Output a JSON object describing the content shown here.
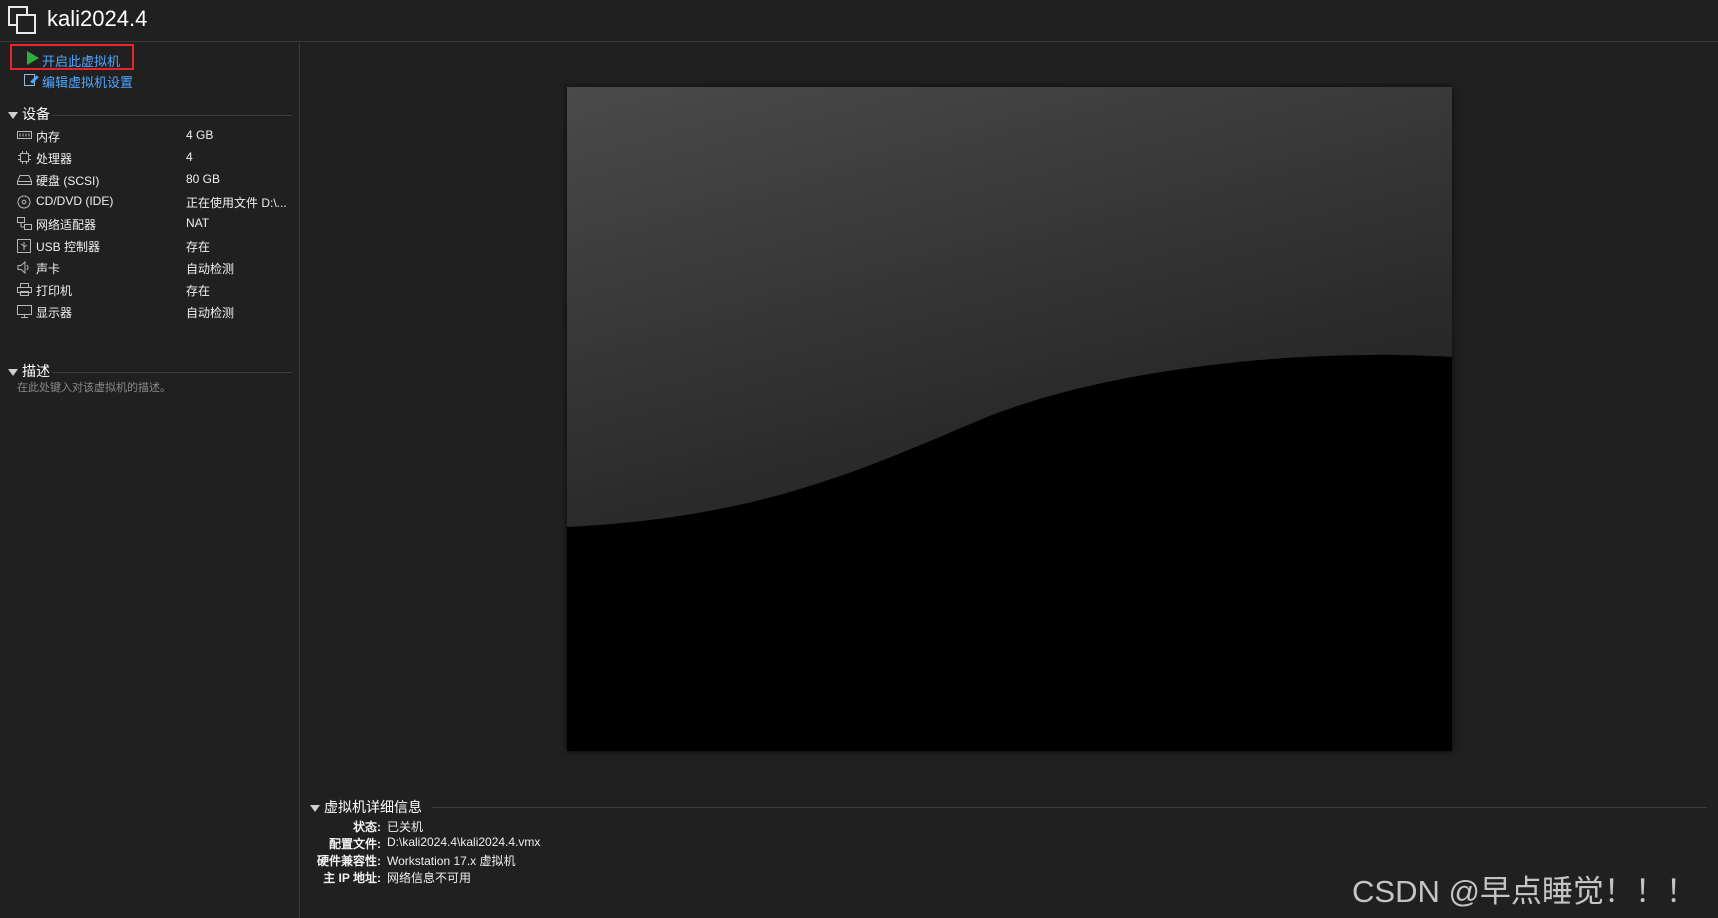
{
  "window": {
    "title": "kali2024.4",
    "icon": "vm-window-icon"
  },
  "actions": {
    "start": {
      "label": "开启此虚拟机",
      "icon": "play-icon",
      "color": "#2fae3b"
    },
    "edit": {
      "label": "编辑虚拟机设置",
      "icon": "edit-settings-icon"
    }
  },
  "devices": {
    "title": "设备",
    "items": [
      {
        "icon": "memory-icon",
        "name": "内存",
        "value": "4 GB"
      },
      {
        "icon": "processor-icon",
        "name": "处理器",
        "value": "4"
      },
      {
        "icon": "hard-disk-icon",
        "name": "硬盘 (SCSI)",
        "value": "80 GB"
      },
      {
        "icon": "cd-dvd-icon",
        "name": "CD/DVD (IDE)",
        "value": "正在使用文件 D:\\..."
      },
      {
        "icon": "network-adapter-icon",
        "name": "网络适配器",
        "value": "NAT"
      },
      {
        "icon": "usb-controller-icon",
        "name": "USB 控制器",
        "value": "存在"
      },
      {
        "icon": "sound-card-icon",
        "name": "声卡",
        "value": "自动检测"
      },
      {
        "icon": "printer-icon",
        "name": "打印机",
        "value": "存在"
      },
      {
        "icon": "display-icon",
        "name": "显示器",
        "value": "自动检测"
      }
    ]
  },
  "description": {
    "title": "描述",
    "placeholder": "在此处键入对该虚拟机的描述。"
  },
  "details": {
    "title": "虚拟机详细信息",
    "rows": [
      {
        "key": "状态:",
        "value": "已关机"
      },
      {
        "key": "配置文件:",
        "value": "D:\\kali2024.4\\kali2024.4.vmx"
      },
      {
        "key": "硬件兼容性:",
        "value": "Workstation 17.x 虚拟机"
      },
      {
        "key": "主 IP 地址:",
        "value": "网络信息不可用"
      }
    ]
  },
  "watermark": "CSDN @早点睡觉！！！",
  "colors": {
    "background": "#202020",
    "link": "#4da6ff",
    "highlight_border": "#e5252c",
    "play": "#2fae3b"
  }
}
